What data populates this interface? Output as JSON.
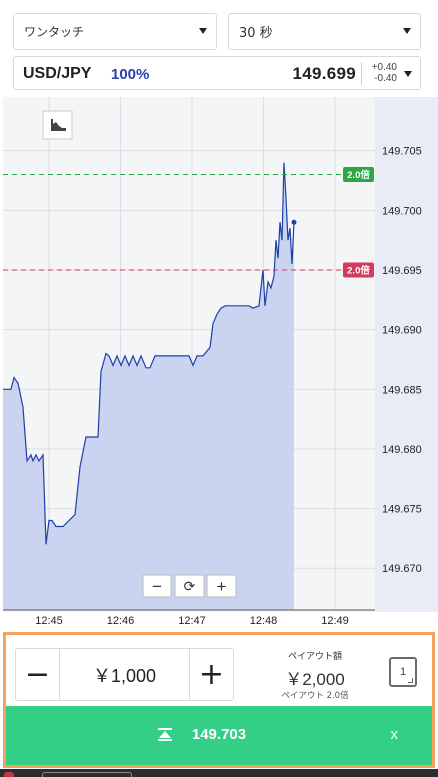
{
  "header": {
    "mode_select": {
      "value": "ワンタッチ"
    },
    "duration_select": {
      "value": "30 秒"
    }
  },
  "pair_bar": {
    "symbol": "USD/JPY",
    "payout_percent": "100%",
    "price": "149.699",
    "delta_up": "+0.40",
    "delta_down": "-0.40"
  },
  "chart_data": {
    "type": "area",
    "title": "",
    "xlabel": "",
    "ylabel": "",
    "ylim": [
      149.6665,
      149.7095
    ],
    "x_ticks": [
      "12:45",
      "12:46",
      "12:47",
      "12:48",
      "12:49"
    ],
    "y_ticks": [
      "149.705",
      "149.700",
      "149.695",
      "149.690",
      "149.685",
      "149.680",
      "149.675",
      "149.670"
    ],
    "series": [
      {
        "values": [
          [
            0,
            149.685
          ],
          [
            8,
            149.685
          ],
          [
            11,
            149.686
          ],
          [
            15,
            149.6855
          ],
          [
            20,
            149.6835
          ],
          [
            24,
            149.679
          ],
          [
            28,
            149.6795
          ],
          [
            30,
            149.679
          ],
          [
            33,
            149.6795
          ],
          [
            36,
            149.679
          ],
          [
            40,
            149.6795
          ],
          [
            43,
            149.672
          ],
          [
            46,
            149.674
          ],
          [
            49,
            149.674
          ],
          [
            53,
            149.6735
          ],
          [
            60,
            149.6735
          ],
          [
            66,
            149.674
          ],
          [
            72,
            149.6745
          ],
          [
            77,
            149.6785
          ],
          [
            83,
            149.681
          ],
          [
            95,
            149.681
          ],
          [
            98,
            149.6865
          ],
          [
            103,
            149.688
          ],
          [
            106,
            149.6878
          ],
          [
            110,
            149.687
          ],
          [
            114,
            149.6878
          ],
          [
            118,
            149.687
          ],
          [
            122,
            149.6878
          ],
          [
            126,
            149.687
          ],
          [
            130,
            149.6878
          ],
          [
            134,
            149.687
          ],
          [
            138,
            149.6878
          ],
          [
            143,
            149.6868
          ],
          [
            147,
            149.6868
          ],
          [
            152,
            149.6878
          ],
          [
            160,
            149.6878
          ],
          [
            175,
            149.6878
          ],
          [
            186,
            149.6878
          ],
          [
            190,
            149.687
          ],
          [
            194,
            149.6878
          ],
          [
            200,
            149.6878
          ],
          [
            207,
            149.6885
          ],
          [
            210,
            149.6905
          ],
          [
            214,
            149.6913
          ],
          [
            218,
            149.6918
          ],
          [
            222,
            149.692
          ],
          [
            230,
            149.692
          ],
          [
            238,
            149.692
          ],
          [
            246,
            149.692
          ],
          [
            250,
            149.6918
          ],
          [
            256,
            149.692
          ],
          [
            260,
            149.695
          ],
          [
            262,
            149.692
          ],
          [
            265,
            149.694
          ],
          [
            268,
            149.6935
          ],
          [
            271,
            149.6945
          ],
          [
            273,
            149.6975
          ],
          [
            275,
            149.696
          ],
          [
            277,
            149.699
          ],
          [
            279,
            149.6975
          ],
          [
            281,
            149.704
          ],
          [
            283,
            149.701
          ],
          [
            285,
            149.6975
          ],
          [
            287,
            149.6985
          ],
          [
            289,
            149.6955
          ],
          [
            291,
            149.699
          ]
        ]
      }
    ],
    "current_price": 149.699,
    "upper_barrier": {
      "value": 149.703,
      "label": "2.0倍"
    },
    "lower_barrier": {
      "value": 149.695,
      "label": "2.0倍"
    },
    "colors": {
      "area": "#c5d0f0",
      "line": "#1e3fa8",
      "upper": "#2aa845",
      "lower": "#d23a5e",
      "bg_left": "#f4f5f7",
      "bg_right": "#e9ecf6"
    },
    "grid": true
  },
  "chart_controls": {
    "minus": "−",
    "reset": "⟳",
    "plus": "+"
  },
  "order": {
    "minus_label": "−",
    "amount": "￥1,000",
    "plus_label": "+",
    "payout_label": "ペイアウト額",
    "payout_value": "￥2,000",
    "payout_rate": "ペイアウト 2.0倍",
    "multiplier": "1",
    "trade_price": "149.703",
    "close_label": "x"
  }
}
